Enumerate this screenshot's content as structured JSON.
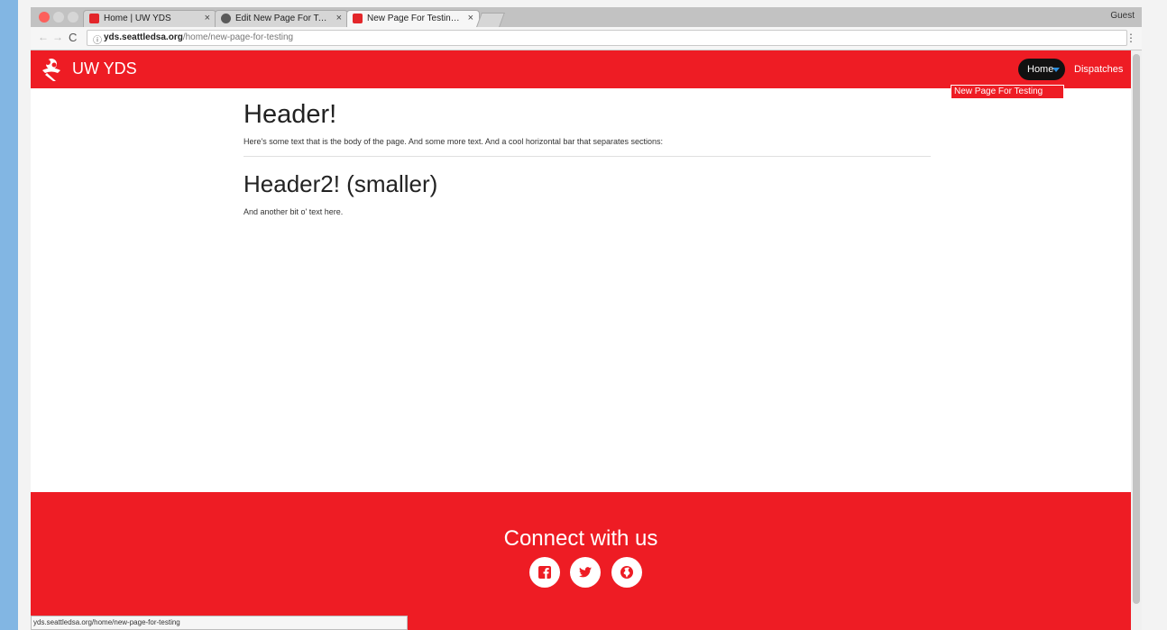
{
  "browser": {
    "tabs": [
      {
        "title": "Home | UW YDS",
        "close": "×"
      },
      {
        "title": "Edit New Page For Testing | UW YDS",
        "close": "×"
      },
      {
        "title": "New Page For Testing | UW YDS",
        "close": "×"
      }
    ],
    "guest_label": "Guest",
    "url_domain": "yds.seattledsa.org",
    "url_path": "/home/new-page-for-testing",
    "status_url": "yds.seattledsa.org/home/new-page-for-testing"
  },
  "site": {
    "brand": "UW YDS",
    "nav": {
      "home": "Home",
      "dispatches": "Dispatches",
      "dropdown_item": "New Page For Testing"
    },
    "content": {
      "header1": "Header!",
      "body1": "Here's some text that is the body of the page. And some more text. And a cool horizontal bar that separates sections:",
      "header2": "Header2! (smaller)",
      "body2": "And another bit o' text here."
    },
    "footer": {
      "connect": "Connect with us"
    }
  },
  "colors": {
    "brand_red": "#ee1c24",
    "nav_active": "#111111"
  }
}
